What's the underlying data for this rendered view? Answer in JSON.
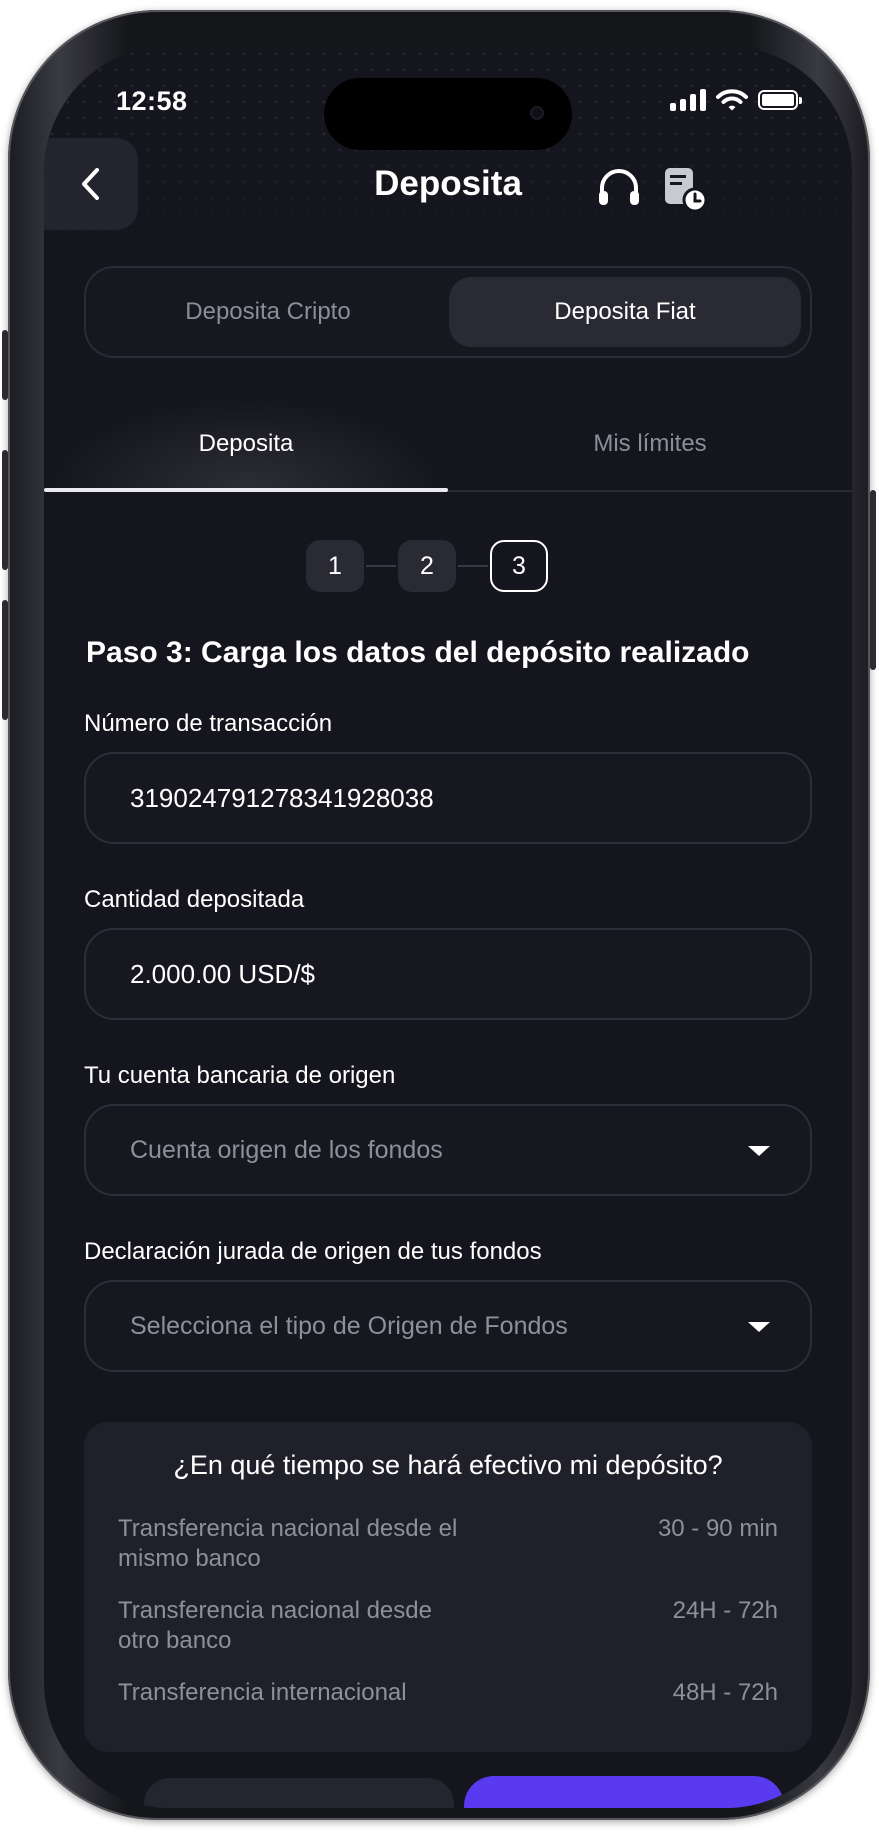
{
  "status_bar": {
    "time": "12:58"
  },
  "header": {
    "title": "Deposita"
  },
  "deposit_type": {
    "crypto_label": "Deposita Cripto",
    "fiat_label": "Deposita Fiat",
    "selected": "Deposita Fiat"
  },
  "tabs": {
    "deposit": "Deposita",
    "limits": "Mis límites"
  },
  "steps": {
    "items": [
      "1",
      "2",
      "3"
    ],
    "current": 3
  },
  "heading": "Paso 3: Carga los datos del depósito realizado",
  "form": {
    "transaction_label": "Número de transacción",
    "transaction_value": "31902479127834192803​8",
    "amount_label": "Cantidad depositada",
    "amount_value": "2.000.00 USD/$",
    "account_label": "Tu cuenta bancaria de origen",
    "account_placeholder": "Cuenta  origen de los fondos",
    "funds_label": "Declaración jurada de origen de tus fondos",
    "funds_placeholder": "Selecciona el tipo de Origen de Fondos"
  },
  "info": {
    "title": "¿En qué tiempo se hará efectivo mi depósito?",
    "rows": [
      {
        "label_line1": "Transferencia nacional desde el",
        "label_line2": "mismo banco",
        "value": "30 - 90 min"
      },
      {
        "label_line1": "Transferencia nacional desde",
        "label_line2": "otro banco",
        "value": "24H - 72h"
      },
      {
        "label_line1": "Transferencia internacional",
        "label_line2": "",
        "value": "48H - 72h"
      }
    ]
  },
  "colors": {
    "background": "#15151d",
    "accent": "#5a3af0",
    "muted_text": "#8f8f9b"
  }
}
